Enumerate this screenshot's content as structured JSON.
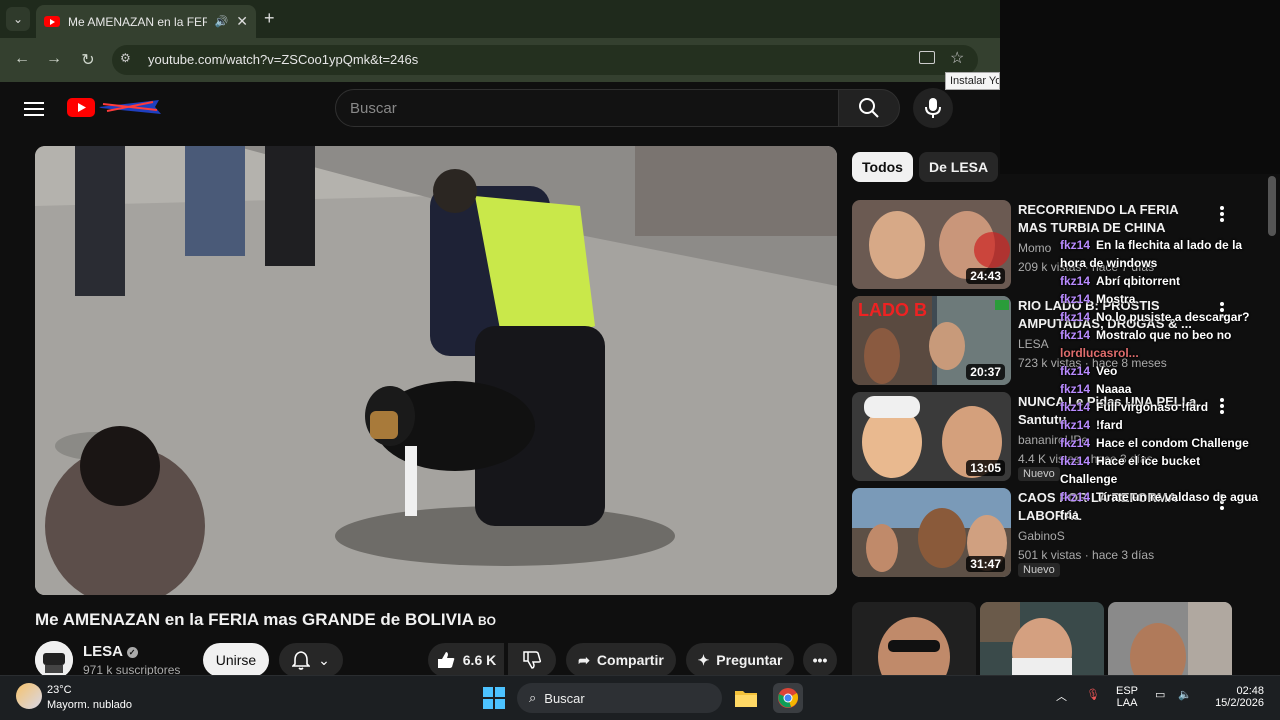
{
  "browser": {
    "tab_title": "Me AMENAZAN en la FERIA",
    "url": "youtube.com/watch?v=ZSCoo1ypQmk&t=246s",
    "tooltip": "Instalar Yo"
  },
  "header": {
    "search_placeholder": "Buscar"
  },
  "video": {
    "title": "Me AMENAZAN en la FERIA mas GRANDE de BOLIVIA",
    "title_flag": "BO",
    "channel": "LESA",
    "subscribers": "971 k suscriptores",
    "join_label": "Unirse",
    "likes": "6.6 K",
    "share_label": "Compartir",
    "ask_label": "Preguntar"
  },
  "chips": [
    "Todos",
    "De LESA"
  ],
  "related": [
    {
      "title": "RECORRIENDO LA FERIA MAS TURBIA DE CHINA",
      "channel": "Momo",
      "meta": "209 k vistas · hace 7 días",
      "duration": "24:43",
      "new": ""
    },
    {
      "title": "RIO LADO B: PROSTIS AMPUTADAS, DROGAS & ...",
      "channel": "LESA",
      "meta": "723 k vistas · hace 8 meses",
      "duration": "20:37",
      "new": ""
    },
    {
      "title": "NUNCA Le Pidas UNA PELI a Santutu",
      "channel": "bananiroUPe",
      "meta": "4.4 K vistas · hace 3 días",
      "duration": "13:05",
      "new": "Nuevo"
    },
    {
      "title": "CAOS POR LA REFORMA LABORAL",
      "channel": "GabinoS",
      "meta": "501 k vistas · hace 3 días",
      "duration": "31:47",
      "new": "Nuevo"
    }
  ],
  "chat": [
    {
      "user": "fkz14",
      "text": "En la flechita al lado de la hora de windows"
    },
    {
      "user": "fkz14",
      "text": "Abrí qbitorrent"
    },
    {
      "user": "fkz14",
      "text": "Mostra"
    },
    {
      "user": "fkz14",
      "text": "No lo pusiste a descargar?"
    },
    {
      "user": "fkz14",
      "text": "Mostralo que no beo no"
    },
    {
      "user": "lordlucasrol...",
      "text": ""
    },
    {
      "user": "fkz14",
      "text": "Veo"
    },
    {
      "user": "fkz14",
      "text": "Naaaa"
    },
    {
      "user": "fkz14",
      "text": "Full virgonaso !fard"
    },
    {
      "user": "fkz14",
      "text": "!fard"
    },
    {
      "user": "fkz14",
      "text": "Hace el condom Challenge"
    },
    {
      "user": "fkz14",
      "text": "Hace el ice bucket Challenge"
    },
    {
      "user": "fkz14",
      "text": "Tírate un re valdaso de agua fria"
    }
  ],
  "taskbar": {
    "temp": "23°C",
    "weather": "Mayorm. nublado",
    "search": "Buscar",
    "lang1": "ESP",
    "lang2": "LAA",
    "time": "02:48",
    "date": "15/2/2026"
  },
  "colors": {
    "youtube_red": "#ff0000",
    "chat_user": "#b98bff"
  }
}
